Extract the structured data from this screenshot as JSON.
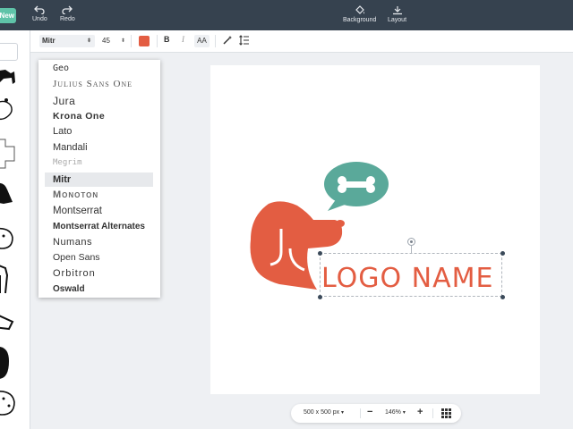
{
  "topbar": {
    "new_label": "New",
    "undo_label": "Undo",
    "redo_label": "Redo",
    "background_label": "Background",
    "layout_label": "Layout"
  },
  "toolbar": {
    "font_value": "Mitr",
    "size_value": "45",
    "text_color": "#e35d42",
    "bold_label": "B",
    "italic_label": "I",
    "case_label": "AA"
  },
  "font_dropdown": {
    "items": [
      "Geo",
      "Julius Sans One",
      "Jura",
      "Krona One",
      "Lato",
      "Mandali",
      "Megrim",
      "Mitr",
      "Monoton",
      "Montserrat",
      "Montserrat Alternates",
      "Numans",
      "Open Sans",
      "Orbitron",
      "Oswald"
    ],
    "selected": "Mitr"
  },
  "canvas": {
    "logo_text": "LOGO NAME",
    "brand_color": "#e35d42",
    "bubble_color": "#5aa99a",
    "icons": [
      "dog-head-icon",
      "speech-bubble-icon",
      "bone-icon"
    ]
  },
  "bottombar": {
    "size_label": "500 x 500 px",
    "zoom_label": "146%",
    "minus_label": "−",
    "plus_label": "+"
  }
}
